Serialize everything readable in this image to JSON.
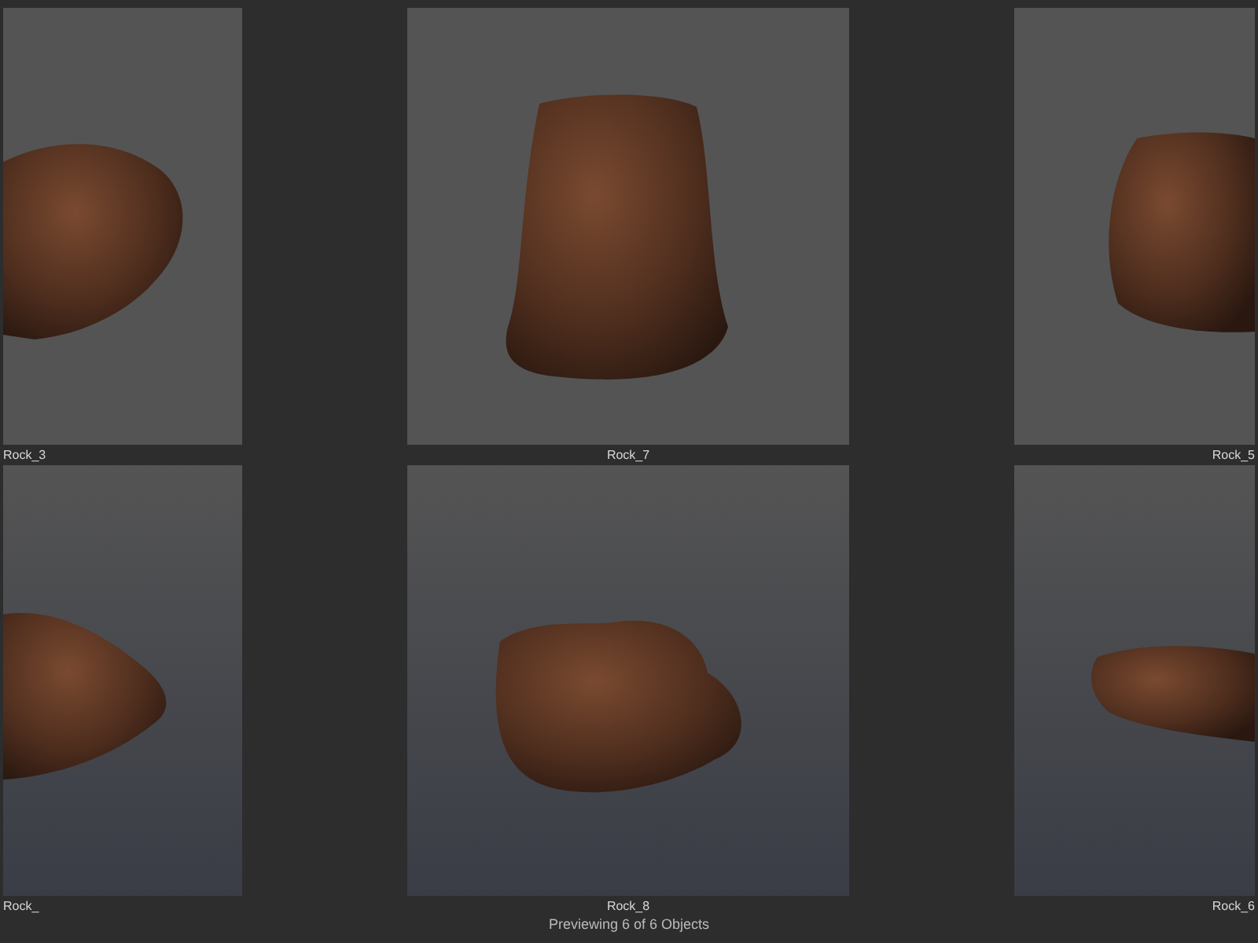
{
  "tiles": [
    {
      "label": "Rock_3"
    },
    {
      "label": "Rock_7"
    },
    {
      "label": "Rock_5"
    },
    {
      "label": "Rock_"
    },
    {
      "label": "Rock_8"
    },
    {
      "label": "Rock_6"
    }
  ],
  "status": "Previewing 6 of 6 Objects"
}
